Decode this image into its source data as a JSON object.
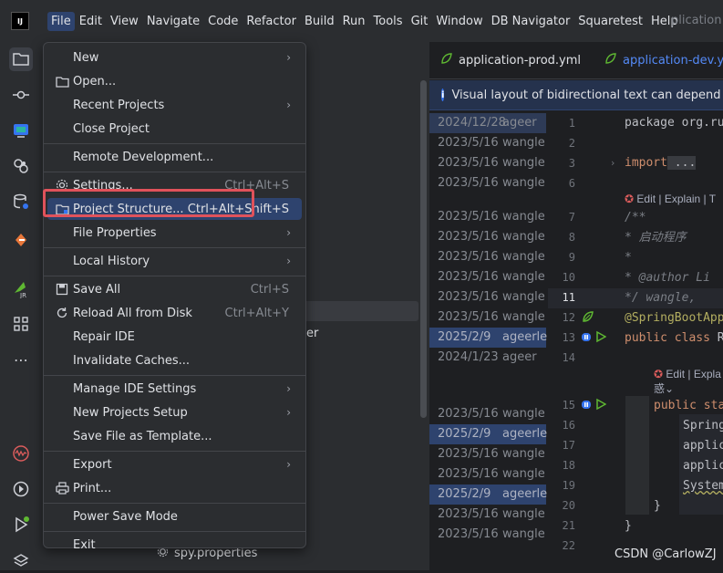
{
  "app": {
    "logo": "IJ",
    "project_title": "plication"
  },
  "menubar": [
    "File",
    "Edit",
    "View",
    "Navigate",
    "Code",
    "Refactor",
    "Build",
    "Run",
    "Tools",
    "Git",
    "Window",
    "DB Navigator",
    "Squaretest",
    "Help"
  ],
  "left_toolbar": [
    "folder-icon",
    "commit-icon",
    "terminal-icon",
    "plugins-icon",
    "database-icon",
    "git-branch-icon",
    "jrebel-icon",
    "structure-icon",
    "more-icon",
    "profiler-icon",
    "services-icon",
    "run-icon",
    "layers-icon"
  ],
  "project_tree": {
    "er_text": "er",
    "file_label": "spy.properties"
  },
  "tabs": [
    {
      "label": "application-prod.yml",
      "active": false
    },
    {
      "label": "application-dev.yml",
      "active": true
    }
  ],
  "banner": {
    "text": "Visual layout of bidirectional text can depend on"
  },
  "file_menu": [
    {
      "label": "New",
      "submenu": true,
      "mn": "N"
    },
    {
      "label": "Open...",
      "icon": "folder-open-icon"
    },
    {
      "label": "Recent Projects",
      "submenu": true
    },
    {
      "label": "Close Project"
    },
    {
      "sep": true
    },
    {
      "label": "Remote Development..."
    },
    {
      "sep": true
    },
    {
      "label": "Settings...",
      "shortcut": "Ctrl+Alt+S",
      "icon": "gear-icon"
    },
    {
      "label": "Project Structure...",
      "shortcut": "Ctrl+Alt+Shift+S",
      "icon": "project-structure-icon",
      "hover": true
    },
    {
      "label": "File Properties",
      "submenu": true
    },
    {
      "sep": true
    },
    {
      "label": "Local History",
      "submenu": true
    },
    {
      "sep": true
    },
    {
      "label": "Save All",
      "shortcut": "Ctrl+S",
      "icon": "save-icon"
    },
    {
      "label": "Reload All from Disk",
      "shortcut": "Ctrl+Alt+Y",
      "icon": "reload-icon"
    },
    {
      "label": "Repair IDE"
    },
    {
      "label": "Invalidate Caches..."
    },
    {
      "sep": true
    },
    {
      "label": "Manage IDE Settings",
      "submenu": true
    },
    {
      "label": "New Projects Setup",
      "submenu": true
    },
    {
      "label": "Save File as Template..."
    },
    {
      "sep": true
    },
    {
      "label": "Export",
      "submenu": true
    },
    {
      "label": "Print...",
      "icon": "print-icon"
    },
    {
      "sep": true
    },
    {
      "label": "Power Save Mode"
    },
    {
      "sep": true
    },
    {
      "label": "Exit"
    }
  ],
  "blame": [
    {
      "date": "2024/12/28",
      "author": "ageer",
      "style": "hl"
    },
    {
      "date": "2023/5/16",
      "author": "wangle"
    },
    {
      "date": "2023/5/16",
      "author": "wangle"
    },
    {
      "date": "2023/5/16",
      "author": "wangle"
    },
    {
      "gap": true
    },
    {
      "date": "2023/5/16",
      "author": "wangle"
    },
    {
      "date": "2023/5/16",
      "author": "wangle"
    },
    {
      "date": "2023/5/16",
      "author": "wangle"
    },
    {
      "date": "2023/5/16",
      "author": "wangle"
    },
    {
      "date": "2023/5/16",
      "author": "wangle"
    },
    {
      "date": "2023/5/16",
      "author": "wangle"
    },
    {
      "date": "2025/2/9",
      "author": "ageerle",
      "style": "sel"
    },
    {
      "date": "2024/1/23",
      "author": "ageer"
    },
    {
      "gap": true
    },
    {
      "gap": true
    },
    {
      "date": "2023/5/16",
      "author": "wangle"
    },
    {
      "date": "2025/2/9",
      "author": "ageerle",
      "style": "sel"
    },
    {
      "date": "2023/5/16",
      "author": "wangle"
    },
    {
      "date": "2023/5/16",
      "author": "wangle"
    },
    {
      "date": "2025/2/9",
      "author": "ageerle",
      "style": "sel"
    },
    {
      "date": "2023/5/16",
      "author": "wangle"
    },
    {
      "date": "2023/5/16",
      "author": "wangle"
    }
  ],
  "line_numbers": [
    "1",
    "2",
    "3",
    "6",
    "",
    "7",
    "8",
    "9",
    "10",
    "11",
    "12",
    "13",
    "14",
    "",
    "",
    "15",
    "16",
    "17",
    "18",
    "19",
    "20",
    "21",
    "22"
  ],
  "code": {
    "l1": "package org.ru",
    "l3_kw": "import",
    "l3_rest": " ...",
    "hint1": "Edit | Explain | T",
    "l7": "/**",
    "l8": " * 启动程序",
    "l9": " *",
    "l10": " * @author Li",
    "l11": " */   wangle,",
    "l12": "@SpringBootApp",
    "l13_kw": "public class",
    "l13_rest": " R",
    "hint2": "Edit | Expla",
    "hint3": "惑",
    "l15_kw": "public sta",
    "l16": "Spring",
    "l17": "applic",
    "l18": "applic",
    "l19": "System",
    "l20": "}",
    "l21": "}"
  },
  "watermark": "CSDN @CarlowZJ"
}
